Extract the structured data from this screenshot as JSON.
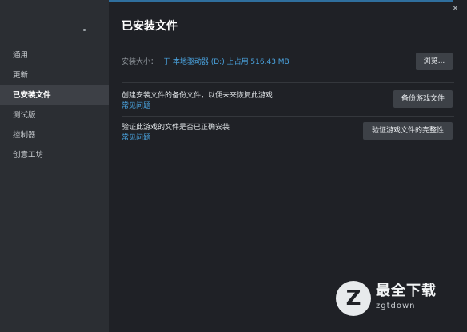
{
  "sidebar": {
    "items": [
      {
        "label": "通用",
        "active": false
      },
      {
        "label": "更新",
        "active": false
      },
      {
        "label": "已安装文件",
        "active": true
      },
      {
        "label": "测试版",
        "active": false
      },
      {
        "label": "控制器",
        "active": false
      },
      {
        "label": "创意工坊",
        "active": false
      }
    ]
  },
  "window": {
    "close_glyph": "✕"
  },
  "page": {
    "title": "已安装文件"
  },
  "install_size": {
    "label": "安装大小：",
    "value": "于 本地驱动器 (D:) 上占用 516.43 MB",
    "browse_label": "浏览..."
  },
  "backup": {
    "description": "创建安装文件的备份文件，以便未来恢复此游戏",
    "faq_link": "常见问题",
    "button_label": "备份游戏文件"
  },
  "verify": {
    "description": "验证此游戏的文件是否已正确安装",
    "faq_link": "常见问题",
    "button_label": "验证游戏文件的完整性"
  },
  "watermark": {
    "logo_glyph": "Z",
    "title": "最全下载",
    "url": "zgtdown"
  },
  "colors": {
    "accent": "#4aa3df",
    "background": "#1f2126",
    "sidebar": "#2b2e33",
    "active_item": "#3d4046"
  }
}
